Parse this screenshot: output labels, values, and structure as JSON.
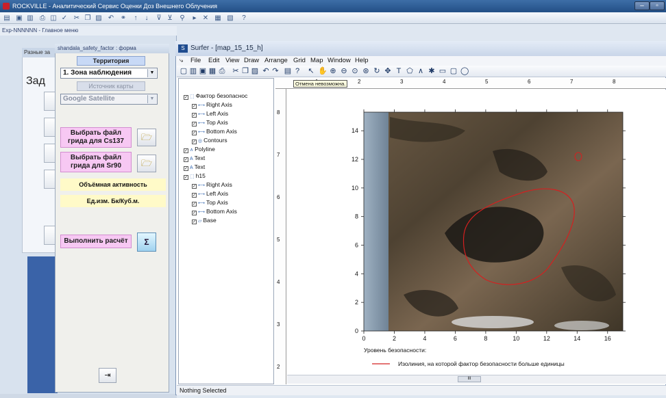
{
  "main_window": {
    "title": "ROCKVILLE - Аналитический Сервис Оценки Доз Внешнего Облучения",
    "exp_title": "Exp-NNNNNN - Главное меню"
  },
  "background_form": {
    "title": "Разные за",
    "big_text": "Зад"
  },
  "factor_form": {
    "title": "shandala_safety_factor : форма",
    "territory_button": "Территория",
    "zone_value": "1. Зона наблюдения",
    "map_source_button": "Источник карты",
    "map_source_value": "Google Satellite",
    "cs137_button": "Выбрать файл грида для Cs137",
    "sr90_button": "Выбрать файл грида для Sr90",
    "activity_label": "Объёмная активность",
    "units_label": "Ед.изм.   Бк/Куб.м.",
    "run_button": "Выполнить расчёт",
    "sigma_label": "Σ"
  },
  "surfer": {
    "title": "Surfer - [map_15_15_h]",
    "menu": [
      "File",
      "Edit",
      "View",
      "Draw",
      "Arrange",
      "Grid",
      "Map",
      "Window",
      "Help"
    ],
    "undo_tooltip": "Отмена невозможна.",
    "status": "Nothing Selected",
    "ruler_top_labels": [
      "1",
      "2",
      "3",
      "4",
      "5",
      "6",
      "7",
      "8"
    ],
    "ruler_left_labels": [
      "8",
      "7",
      "6",
      "5",
      "4",
      "3",
      "2"
    ],
    "tree": [
      {
        "label": "Фактор безопаснос",
        "level": 0,
        "icon": "frame"
      },
      {
        "label": "Right Axis",
        "level": 1,
        "icon": "axis"
      },
      {
        "label": "Left Axis",
        "level": 1,
        "icon": "axis"
      },
      {
        "label": "Top Axis",
        "level": 1,
        "icon": "axis"
      },
      {
        "label": "Bottom Axis",
        "level": 1,
        "icon": "axis"
      },
      {
        "label": "Contours",
        "level": 1,
        "icon": "contours"
      },
      {
        "label": "Polyline",
        "level": 0,
        "icon": "polyline"
      },
      {
        "label": "Text",
        "level": 0,
        "icon": "text"
      },
      {
        "label": "Text",
        "level": 0,
        "icon": "text"
      },
      {
        "label": "h15",
        "level": 0,
        "icon": "frame"
      },
      {
        "label": "Right Axis",
        "level": 1,
        "icon": "axis"
      },
      {
        "label": "Left Axis",
        "level": 1,
        "icon": "axis"
      },
      {
        "label": "Top Axis",
        "level": 1,
        "icon": "axis"
      },
      {
        "label": "Bottom Axis",
        "level": 1,
        "icon": "axis"
      },
      {
        "label": "Base",
        "level": 1,
        "icon": "base"
      }
    ],
    "plot": {
      "x_ticks": [
        "0",
        "2",
        "4",
        "6",
        "8",
        "10",
        "12",
        "14",
        "16"
      ],
      "y_ticks": [
        "0",
        "2",
        "4",
        "6",
        "8",
        "10",
        "12",
        "14"
      ],
      "legend_title": "Уровень безопасности:",
      "legend_entry": "Изолиния, на которой фактор безопасности больше единицы",
      "contour_color": "#d42020"
    },
    "scroll_thumb": "III"
  },
  "colors": {
    "title_bar": "#2c5c96",
    "pink_button": "#f7c8f3",
    "blue_button": "#c8d9f6",
    "yellow_label": "#fffac8"
  }
}
